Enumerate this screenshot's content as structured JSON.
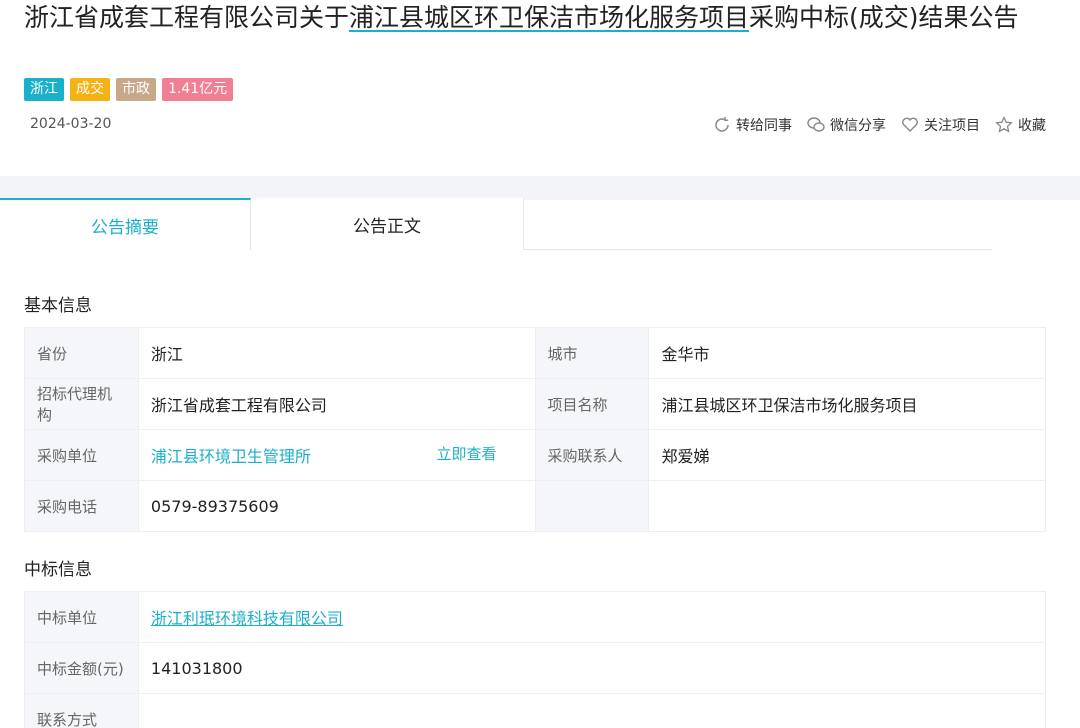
{
  "header": {
    "title_part1": "浙江省成套工程有限公司关于",
    "title_highlight": "浦江县城区环卫保洁市场化服务项目",
    "title_part2": "采购中标(成交)结果公告"
  },
  "tags": [
    {
      "label": "浙江",
      "color": "#1bb0c9"
    },
    {
      "label": "成交",
      "color": "#f5b313"
    },
    {
      "label": "市政",
      "color": "#c7a98a"
    },
    {
      "label": "1.41亿元",
      "color": "#f07f92"
    }
  ],
  "date": "2024-03-20",
  "actions": {
    "forward": "转给同事",
    "wechat": "微信分享",
    "follow": "关注项目",
    "favorite": "收藏"
  },
  "tabs": [
    "公告摘要",
    "公告正文"
  ],
  "basic": {
    "section": "基本信息",
    "province_label": "省份",
    "province": "浙江",
    "city_label": "城市",
    "city": "金华市",
    "agency_label": "招标代理机构",
    "agency": "浙江省成套工程有限公司",
    "project_label": "项目名称",
    "project": "浦江县城区环卫保洁市场化服务项目",
    "buyer_label": "采购单位",
    "buyer": "浦江县环境卫生管理所",
    "view_now": "立即查看",
    "contact_label": "采购联系人",
    "contact": "郑爱娣",
    "phone_label": "采购电话",
    "phone": "0579-89375609"
  },
  "award": {
    "section": "中标信息",
    "winner_label": "中标单位",
    "winner": "浙江利珉环境科技有限公司",
    "amount_label": "中标金额(元)",
    "amount": "141031800",
    "contact_label": "联系方式",
    "contact": ""
  }
}
